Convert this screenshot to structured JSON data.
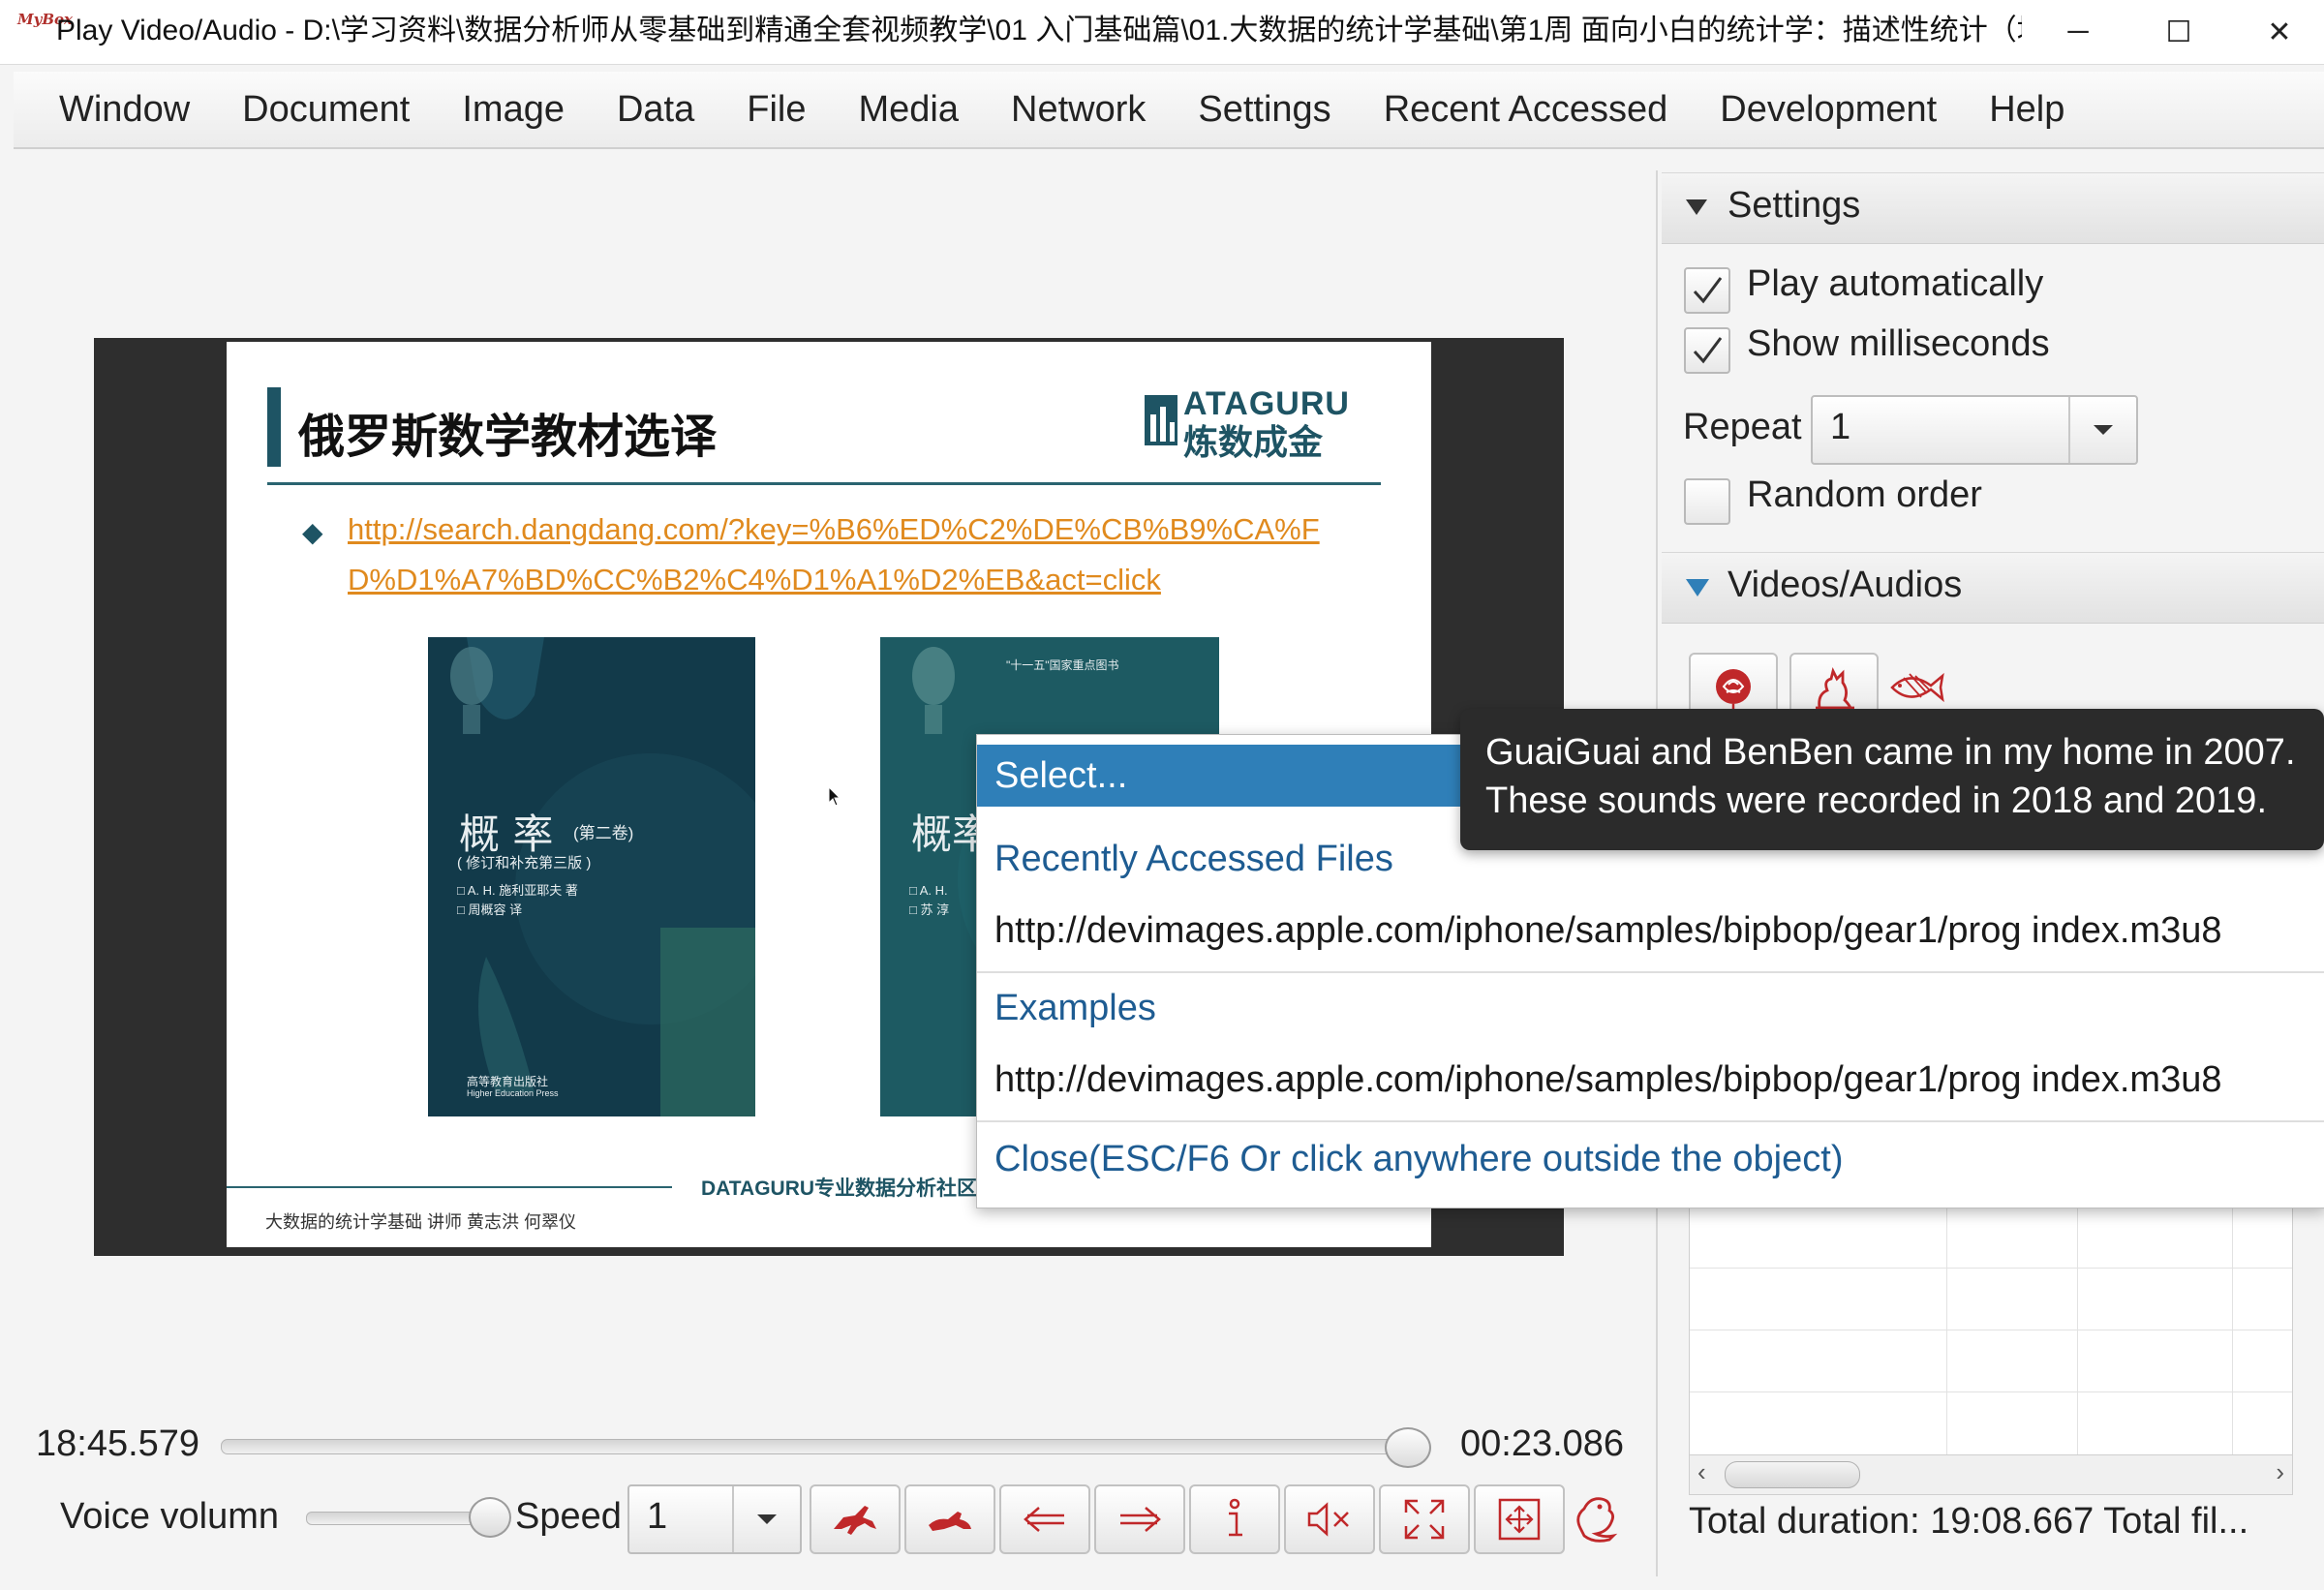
{
  "window": {
    "app_icon_text": "MyBox",
    "title": "Play Video/Audio - D:\\学习资料\\数据分析师从零基础到精通全套视频教学\\01 入门基础篇\\01.大数据的统计学基础\\第1周 面向小白的统计学：描述性统计（均值，中位...",
    "controls": {
      "minimize": "─",
      "maximize": "☐",
      "close": "✕"
    }
  },
  "menubar": {
    "items": [
      "Window",
      "Document",
      "Image",
      "Data",
      "File",
      "Media",
      "Network",
      "Settings",
      "Recent Accessed",
      "Development",
      "Help"
    ]
  },
  "video": {
    "slide": {
      "title": "俄罗斯数学教材选译",
      "logo_top": "ATAGURU",
      "logo_bottom": "炼数成金",
      "bullet": "◆",
      "link": "http://search.dangdang.com/?key=%B6%ED%C2%DE%CB%B9%CA%FD%D1%A7%BD%CC%B2%C4%D1%A1%D2%EB&act=click",
      "book1": {
        "title": "概 率",
        "volume": "(第二卷)",
        "edition": "( 修订和补充第三版 )",
        "authors": [
          "□ A. H. 施利亚耶夫  著",
          "□ 周概容  译"
        ],
        "publisher": "高等教育出版社",
        "publisher_en": "Higher Education Press"
      },
      "book2": {
        "tag": "\"十一五\"国家重点图书",
        "title": "概率",
        "authors": [
          "□ A. H.",
          "□ 苏 淳"
        ]
      },
      "community": "DATAGURU专业数据分析社区",
      "course": "大数据的统计学基础   讲师 黄志洪 何翠仪"
    }
  },
  "player": {
    "current_time": "18:45.579",
    "remaining_time": "00:23.086",
    "progress_fraction": 0.981,
    "volume_label": "Voice volumn",
    "volume_fraction": 1.0,
    "speed_label": "Speed",
    "speed_value": "1",
    "buttons": [
      "previous-animal-icon",
      "next-animal-icon",
      "back-arrow-icon",
      "forward-arrow-icon",
      "info-icon",
      "mute-icon",
      "fullscreen-icon",
      "fit-window-icon",
      "dragon-icon"
    ]
  },
  "settings": {
    "header": "Settings",
    "play_automatically": {
      "label": "Play automatically",
      "checked": true
    },
    "show_milliseconds": {
      "label": "Show milliseconds",
      "checked": true
    },
    "repeat_label": "Repeat",
    "repeat_value": "1",
    "random_order": {
      "label": "Random order",
      "checked": false
    }
  },
  "videos_audios": {
    "header": "Videos/Audios",
    "icons": [
      "rose-icon",
      "cat-icon",
      "fish-icon"
    ],
    "total_text": "Total duration: 19:08.667   Total fil..."
  },
  "popup_menu": {
    "select_label": "Select...",
    "recent_header": "Recently Accessed Files",
    "recent_url": "http://devimages.apple.com/iphone/samples/bipbop/gear1/prog index.m3u8",
    "examples_header": "Examples",
    "example_url": "http://devimages.apple.com/iphone/samples/bipbop/gear1/prog index.m3u8",
    "close_label": "Close(ESC/F6 Or click anywhere outside the object)"
  },
  "tooltip": {
    "line1": "GuaiGuai and BenBen came in my home in 2007.",
    "line2": "These sounds were recorded in 2018 and 2019."
  },
  "colors": {
    "accent_blue": "#2f7fb8",
    "link_orange": "#e08a1e",
    "icon_red": "#c0282a",
    "slide_teal": "#1e5464"
  }
}
